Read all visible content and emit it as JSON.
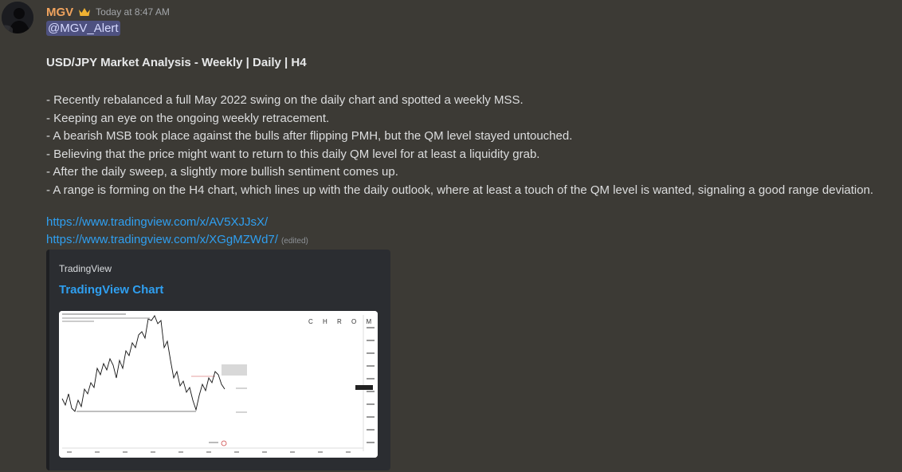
{
  "message": {
    "username": "MGV",
    "timestamp": "Today at 8:47 AM",
    "mention": "@MGV_Alert",
    "title": "USD/JPY Market Analysis - Weekly | Daily | H4",
    "bullets": [
      "- Recently rebalanced a full May 2022 swing on the daily chart and spotted a weekly MSS.",
      "- Keeping an eye on the ongoing weekly retracement.",
      "- A bearish MSB took place against the bulls after flipping PMH, but the QM level stayed untouched.",
      "- Believing that the price might want to return to this daily QM level for at least a liquidity grab.",
      "- After the daily sweep, a slightly more bullish sentiment comes up.",
      "- A range is forming on the H4 chart, which lines up with the daily outlook, where at least a touch of the QM level is wanted, signaling a good range deviation."
    ],
    "links": [
      "https://www.tradingview.com/x/AV5XJJsX/",
      "https://www.tradingview.com/x/XGgMZWd7/"
    ],
    "edited_label": "(edited)"
  },
  "embed": {
    "provider": "TradingView",
    "title": "TradingView Chart",
    "image_watermark": "C H R O M A"
  },
  "colors": {
    "background": "#3c3a35",
    "username": "#f0a35e",
    "link": "#2f9ff0",
    "mention_bg": "#4e5180",
    "embed_bg": "#2b2d31"
  },
  "icons": {
    "crown": "crown-icon",
    "avatar": "avatar"
  }
}
